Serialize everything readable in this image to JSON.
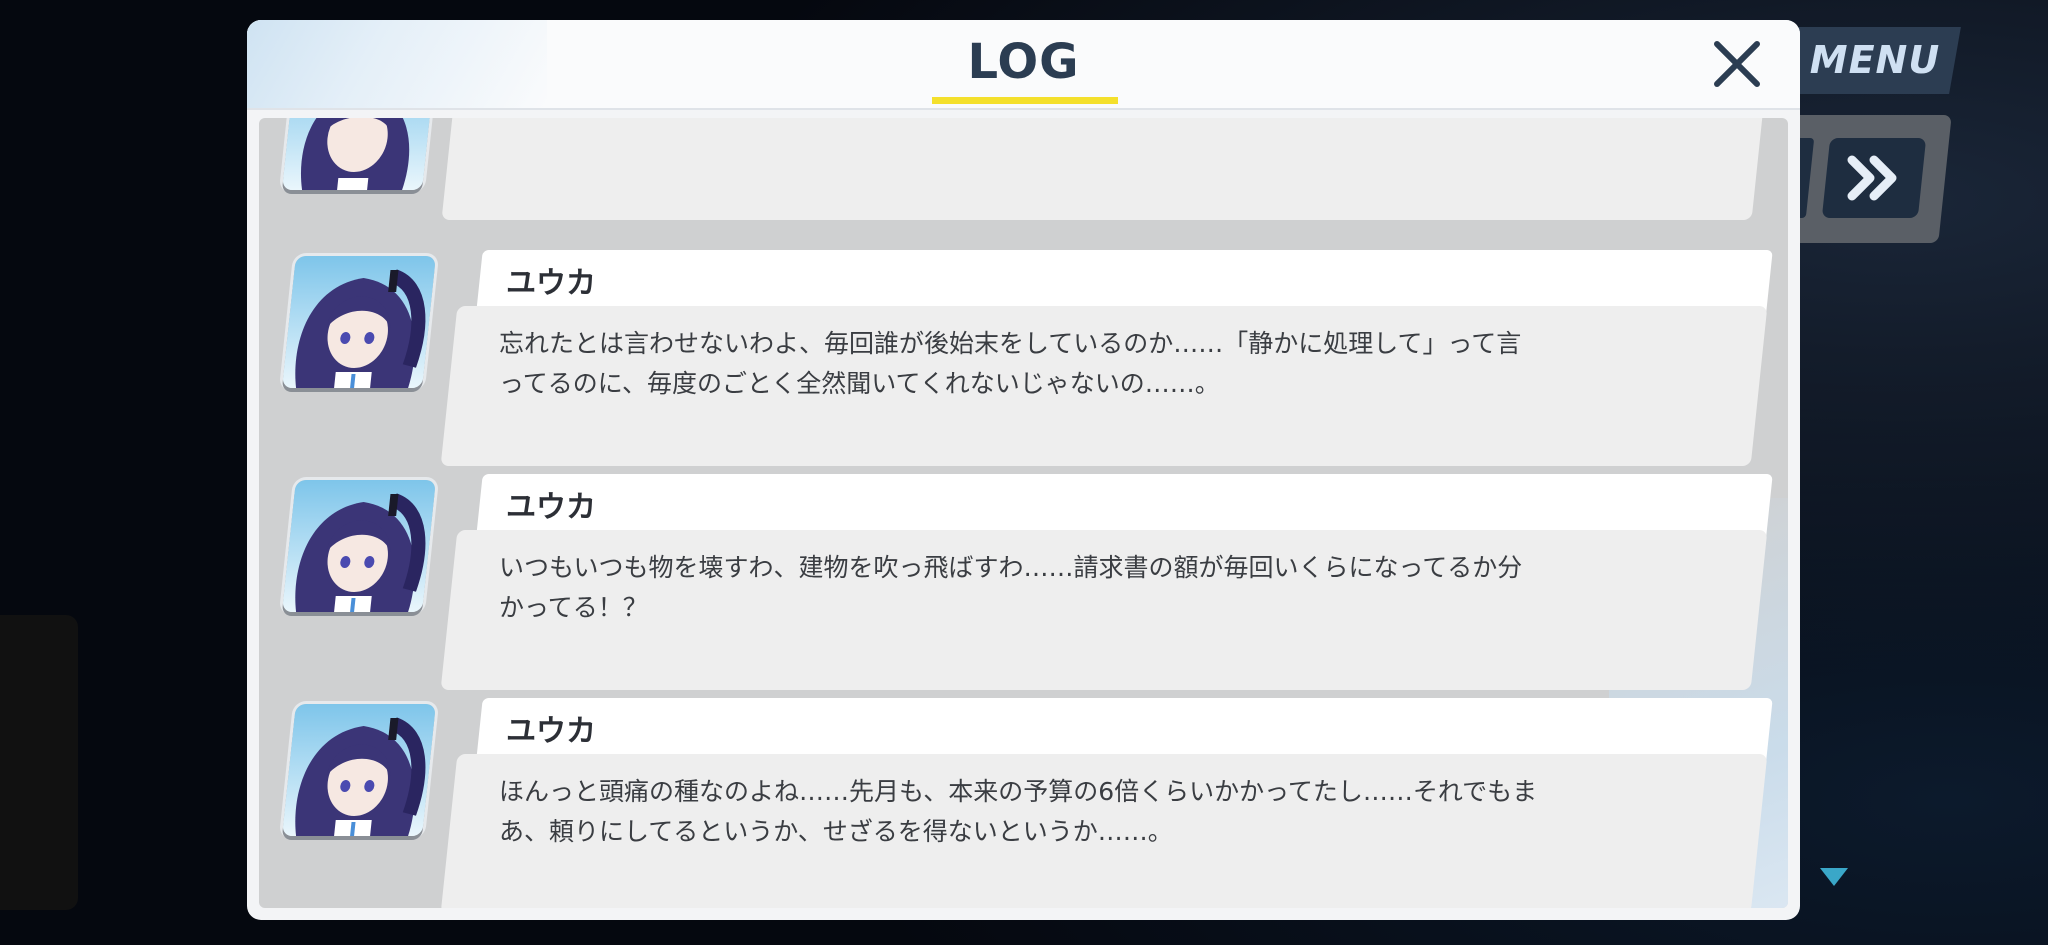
{
  "hud": {
    "menu_label": "MENU",
    "fast_forward_icon": "double-chevron-right-icon",
    "scroll_indicator_icon": "triangle-down-icon"
  },
  "dialog": {
    "title": "LOG",
    "close_icon": "close-icon",
    "accent_color": "#f4e02c"
  },
  "log_entries": [
    {
      "speaker": "",
      "message": ""
    },
    {
      "speaker": "ユウカ",
      "message": "忘れたとは言わせないわよ、毎回誰が後始末をしているのか……「静かに処理して」って言ってるのに、毎度のごとく全然聞いてくれないじゃないの……。"
    },
    {
      "speaker": "ユウカ",
      "message": "いつもいつも物を壊すわ、建物を吹っ飛ばすわ……請求書の額が毎回いくらになってるか分かってる！？"
    },
    {
      "speaker": "ユウカ",
      "message": "ほんっと頭痛の種なのよね……先月も、本来の予算の6倍くらいかかってたし……それでもまあ、頼りにしてるというか、せざるを得ないというか……。"
    }
  ]
}
